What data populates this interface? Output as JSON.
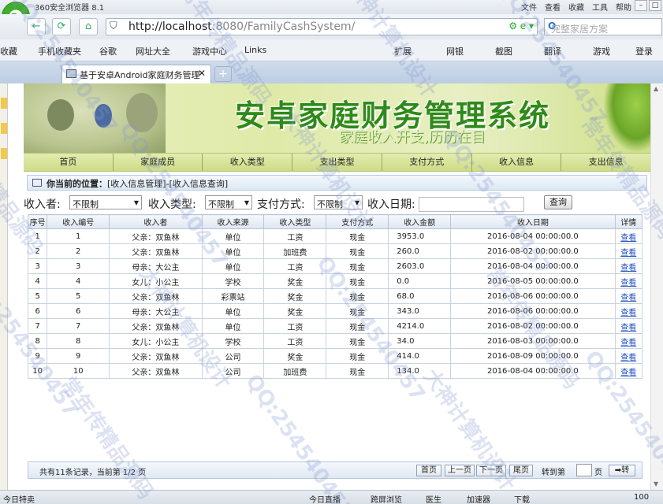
{
  "browser": {
    "app_title": "360安全浏览器 8.1",
    "menus": [
      "文件",
      "查看",
      "收藏",
      "工具",
      "帮助"
    ],
    "address": {
      "host": "http://localhost",
      "rest": ":8080/FamilyCashSystem/"
    },
    "search_placeholder": "完整家居方案",
    "favorites": [
      "收藏",
      "手机收藏夹",
      "谷歌",
      "网址大全",
      "游戏中心",
      "Links",
      "扩展",
      "网银",
      "截图",
      "翻译",
      "游戏",
      "登录"
    ],
    "tab_title": "基于安卓Android家庭财务管理",
    "status": {
      "left": "今日特卖",
      "items": [
        "今日直播",
        "跨屏浏览",
        "医生",
        "加速器",
        "下载"
      ],
      "zoom": "100"
    }
  },
  "banner": {
    "title": "安卓家庭财务管理系统",
    "subtitle": "家庭收入开支,历历在目"
  },
  "menu": [
    "首页",
    "家庭成员",
    "收入类型",
    "支出类型",
    "支付方式",
    "收入信息",
    "支出信息"
  ],
  "crumb": {
    "label": "你当前的位置：",
    "path": "[收入信息管理]-[收入信息查询]"
  },
  "filters": {
    "receiver_label": "收入者:",
    "receiver_value": "不限制",
    "type_label": "收入类型:",
    "type_value": "不限制",
    "pay_label": "支付方式:",
    "pay_value": "不限制",
    "date_label": "收入日期:",
    "date_value": "",
    "query_button": "查询"
  },
  "table": {
    "headers": [
      "序号",
      "收入编号",
      "收入者",
      "收入来源",
      "收入类型",
      "支付方式",
      "收入金额",
      "收入日期",
      "详情"
    ],
    "rows": [
      [
        "1",
        "1",
        "父亲：双鱼林",
        "单位",
        "工资",
        "现金",
        "3953.0",
        "2016-08-04 00:00:00.0",
        "查看"
      ],
      [
        "2",
        "2",
        "父亲：双鱼林",
        "单位",
        "加班费",
        "现金",
        "260.0",
        "2016-08-02 00:00:00.0",
        "查看"
      ],
      [
        "3",
        "3",
        "母亲：大公主",
        "单位",
        "工资",
        "现金",
        "2603.0",
        "2016-08-04 00:00:00.0",
        "查看"
      ],
      [
        "4",
        "4",
        "女儿：小公主",
        "学校",
        "奖金",
        "现金",
        "0.0",
        "2016-08-05 00:00:00.0",
        "查看"
      ],
      [
        "5",
        "5",
        "父亲：双鱼林",
        "彩票站",
        "奖金",
        "现金",
        "68.0",
        "2016-08-06 00:00:00.0",
        "查看"
      ],
      [
        "6",
        "6",
        "母亲：大公主",
        "单位",
        "奖金",
        "现金",
        "343.0",
        "2016-08-06 00:00:00.0",
        "查看"
      ],
      [
        "7",
        "7",
        "父亲：双鱼林",
        "单位",
        "工资",
        "现金",
        "4214.0",
        "2016-08-02 00:00:00.0",
        "查看"
      ],
      [
        "8",
        "8",
        "女儿：小公主",
        "学校",
        "工资",
        "现金",
        "34.0",
        "2016-08-03 00:00:00.0",
        "查看"
      ],
      [
        "9",
        "9",
        "父亲：双鱼林",
        "公司",
        "奖金",
        "现金",
        "414.0",
        "2016-08-09 00:00:00.0",
        "查看"
      ],
      [
        "10",
        "10",
        "父亲：双鱼林",
        "公司",
        "加班费",
        "现金",
        "134.0",
        "2016-08-04 00:00:00.0",
        "查看"
      ]
    ]
  },
  "pager": {
    "info": "共有11条记录，当前第 1/2 页",
    "first": "首页",
    "prev": "上一页",
    "next": "下一页",
    "last": "尾页",
    "jump_to": "转到第",
    "page_unit": "页",
    "go": "转"
  },
  "watermark": {
    "texts": [
      "QQ:254540457",
      "常年传精品源码",
      "大神计算机设计"
    ]
  }
}
